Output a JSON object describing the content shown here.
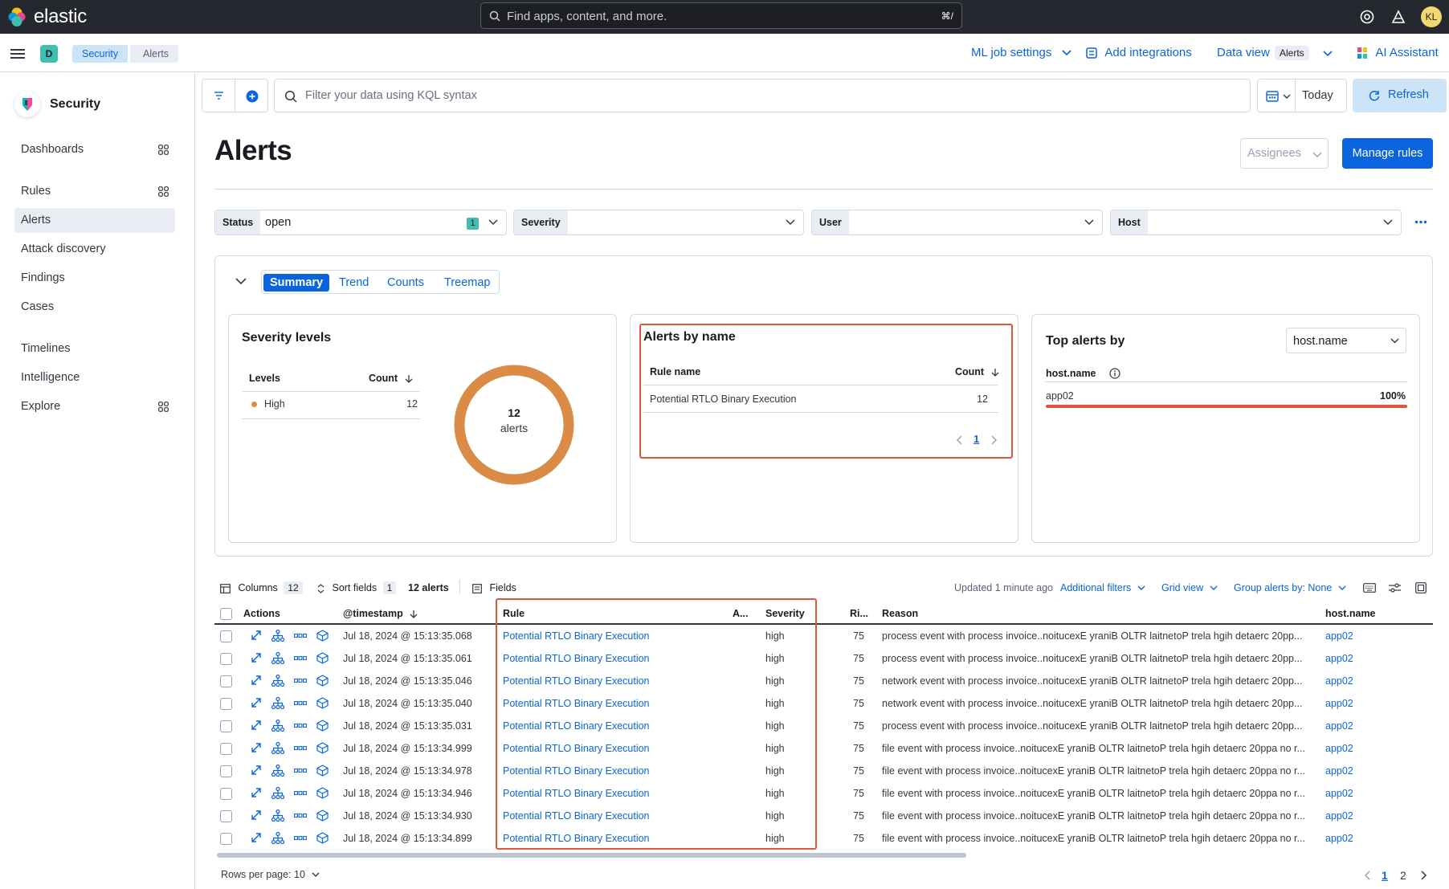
{
  "topbar": {
    "brand": "elastic",
    "search_placeholder": "Find apps, content, and more.",
    "search_shortcut": "⌘/",
    "avatar_initials": "KL"
  },
  "header": {
    "space_initial": "D",
    "breadcrumbs": [
      "Security",
      "Alerts"
    ],
    "ml_job_settings": "ML job settings",
    "add_integrations": "Add integrations",
    "data_view_label": "Data view",
    "data_view_value": "Alerts",
    "ai_assistant": "AI Assistant"
  },
  "sidebar": {
    "title": "Security",
    "items": [
      {
        "label": "Dashboards"
      },
      {
        "label": "Rules"
      },
      {
        "label": "Alerts"
      },
      {
        "label": "Attack discovery"
      },
      {
        "label": "Findings"
      },
      {
        "label": "Cases"
      },
      {
        "label": "Timelines"
      },
      {
        "label": "Intelligence"
      },
      {
        "label": "Explore"
      }
    ]
  },
  "filterbar": {
    "kql_placeholder": "Filter your data using KQL syntax",
    "date_label": "Today",
    "refresh_label": "Refresh"
  },
  "page": {
    "title": "Alerts",
    "assignees_label": "Assignees",
    "manage_rules_label": "Manage rules"
  },
  "filters": {
    "status_label": "Status",
    "status_value": "open",
    "status_count": "1",
    "severity_label": "Severity",
    "user_label": "User",
    "host_label": "Host"
  },
  "summary": {
    "tabs": [
      "Summary",
      "Trend",
      "Counts",
      "Treemap"
    ],
    "severity": {
      "title": "Severity levels",
      "col_levels": "Levels",
      "col_count": "Count",
      "rows": [
        {
          "level": "High",
          "count": "12"
        }
      ],
      "donut_count": "12",
      "donut_unit": "alerts",
      "donut_color": "#da8b45"
    },
    "alerts_by_name": {
      "title": "Alerts by name",
      "col_rule": "Rule name",
      "col_count": "Count",
      "rows": [
        {
          "rule": "Potential RTLO Binary Execution",
          "count": "12"
        }
      ],
      "page": "1"
    },
    "top_alerts": {
      "title": "Top alerts by",
      "group_by": "host.name",
      "field_label": "host.name",
      "rows": [
        {
          "value": "app02",
          "percent": "100%"
        }
      ]
    }
  },
  "table_toolbar": {
    "columns_label": "Columns",
    "columns_count": "12",
    "sort_label": "Sort fields",
    "sort_count": "1",
    "alerts_count": "12 alerts",
    "fields_label": "Fields",
    "updated": "Updated 1 minute ago",
    "additional_filters": "Additional filters",
    "grid_view": "Grid view",
    "group_by": "Group alerts by: None"
  },
  "grid": {
    "headers": {
      "actions": "Actions",
      "timestamp": "@timestamp",
      "rule": "Rule",
      "assignees": "A...",
      "severity": "Severity",
      "risk": "Ri...",
      "reason": "Reason",
      "host": "host.name"
    },
    "rows": [
      {
        "timestamp": "Jul 18, 2024 @ 15:13:35.068",
        "rule": "Potential RTLO Binary Execution",
        "severity": "high",
        "risk": "75",
        "reason": "process event with process invoice..noitucexE yraniB OLTR laitnetoP trela hgih detaerc 20pp...",
        "host": "app02"
      },
      {
        "timestamp": "Jul 18, 2024 @ 15:13:35.061",
        "rule": "Potential RTLO Binary Execution",
        "severity": "high",
        "risk": "75",
        "reason": "process event with process invoice..noitucexE yraniB OLTR laitnetoP trela hgih detaerc 20pp...",
        "host": "app02"
      },
      {
        "timestamp": "Jul 18, 2024 @ 15:13:35.046",
        "rule": "Potential RTLO Binary Execution",
        "severity": "high",
        "risk": "75",
        "reason": "network event with process invoice..noitucexE yraniB OLTR laitnetoP trela hgih detaerc 20pp...",
        "host": "app02"
      },
      {
        "timestamp": "Jul 18, 2024 @ 15:13:35.040",
        "rule": "Potential RTLO Binary Execution",
        "severity": "high",
        "risk": "75",
        "reason": "network event with process invoice..noitucexE yraniB OLTR laitnetoP trela hgih detaerc 20pp...",
        "host": "app02"
      },
      {
        "timestamp": "Jul 18, 2024 @ 15:13:35.031",
        "rule": "Potential RTLO Binary Execution",
        "severity": "high",
        "risk": "75",
        "reason": "process event with process invoice..noitucexE yraniB OLTR laitnetoP trela hgih detaerc 20pp...",
        "host": "app02"
      },
      {
        "timestamp": "Jul 18, 2024 @ 15:13:34.999",
        "rule": "Potential RTLO Binary Execution",
        "severity": "high",
        "risk": "75",
        "reason": "file event with process invoice..noitucexE yraniB OLTR laitnetoP trela hgih detaerc 20ppa no r...",
        "host": "app02"
      },
      {
        "timestamp": "Jul 18, 2024 @ 15:13:34.978",
        "rule": "Potential RTLO Binary Execution",
        "severity": "high",
        "risk": "75",
        "reason": "file event with process invoice..noitucexE yraniB OLTR laitnetoP trela hgih detaerc 20ppa no r...",
        "host": "app02"
      },
      {
        "timestamp": "Jul 18, 2024 @ 15:13:34.946",
        "rule": "Potential RTLO Binary Execution",
        "severity": "high",
        "risk": "75",
        "reason": "file event with process invoice..noitucexE yraniB OLTR laitnetoP trela hgih detaerc 20ppa no r...",
        "host": "app02"
      },
      {
        "timestamp": "Jul 18, 2024 @ 15:13:34.930",
        "rule": "Potential RTLO Binary Execution",
        "severity": "high",
        "risk": "75",
        "reason": "file event with process invoice..noitucexE yraniB OLTR laitnetoP trela hgih detaerc 20ppa no r...",
        "host": "app02"
      },
      {
        "timestamp": "Jul 18, 2024 @ 15:13:34.899",
        "rule": "Potential RTLO Binary Execution",
        "severity": "high",
        "risk": "75",
        "reason": "file event with process invoice..noitucexE yraniB OLTR laitnetoP trela hgih detaerc 20ppa no r...",
        "host": "app02"
      }
    ]
  },
  "footer": {
    "rows_per_page": "Rows per page: 10",
    "pages": [
      "1",
      "2"
    ]
  },
  "colors": {
    "accent": "#0b64dd",
    "high_severity": "#da8b45",
    "highlight": "#e0563a"
  }
}
